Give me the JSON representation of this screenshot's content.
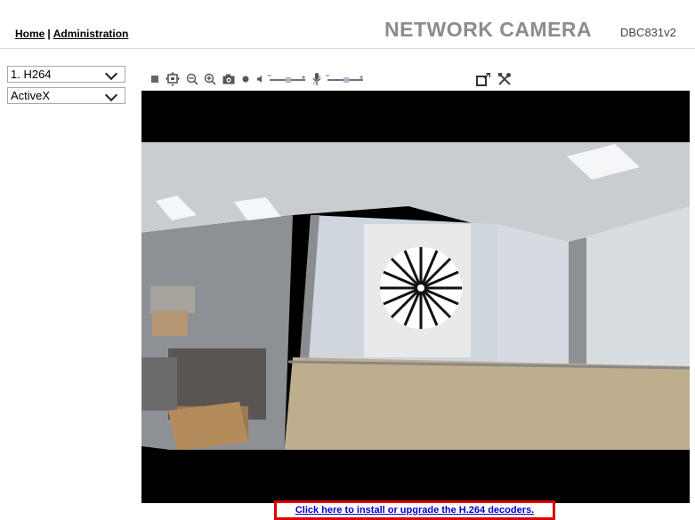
{
  "header": {
    "nav_home": "Home",
    "nav_separator": "|",
    "nav_admin": "Administration",
    "brand": "NETWORK CAMERA",
    "model": "DBC831v2"
  },
  "sidebar": {
    "stream_select": {
      "value": "1. H264"
    },
    "plugin_select": {
      "value": "ActiveX"
    }
  },
  "toolbar": {
    "icons": [
      "stop-icon",
      "digital-ptz-icon",
      "zoom-out-icon",
      "zoom-in-icon",
      "snapshot-icon",
      "record-icon",
      "speaker-icon",
      "volume-slider",
      "microphone-icon",
      "mic-volume-slider",
      "fullscreen-icon",
      "settings-icon"
    ]
  },
  "viewer": {
    "content": "live-video-feed"
  },
  "footer": {
    "decoder_link": "Click here to install or upgrade the H.264 decoders.",
    "highlight_color": "#e00000"
  }
}
